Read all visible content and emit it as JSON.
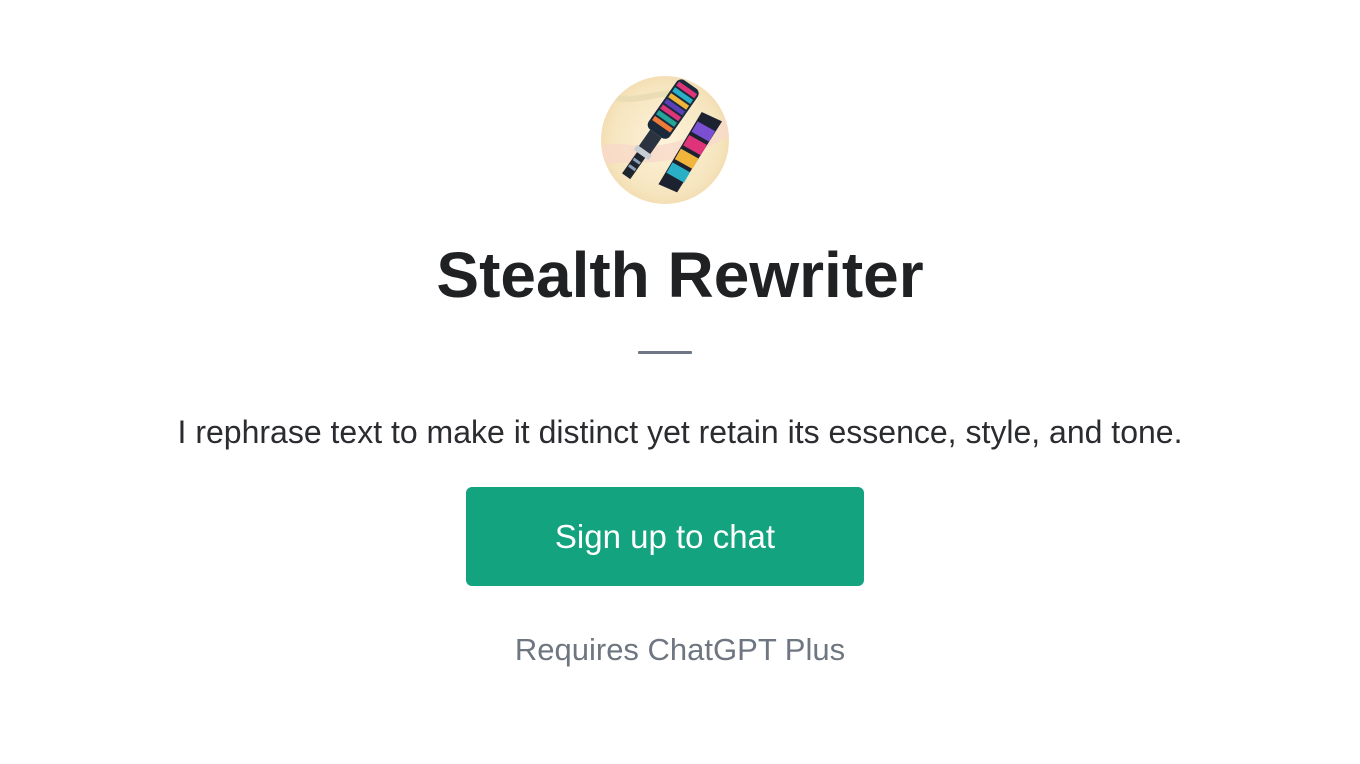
{
  "gpt": {
    "avatar_icon": "multicolored-tools-illustration-icon",
    "title": "Stealth Rewriter",
    "description": "I rephrase text to make it distinct yet retain its essence, style, and tone."
  },
  "actions": {
    "signup_label": "Sign up to chat",
    "requirement_note": "Requires ChatGPT Plus"
  },
  "colors": {
    "button_bg": "#14a37f",
    "title_text": "#202123",
    "muted_text": "#6e7681",
    "divider": "#6e7785"
  }
}
